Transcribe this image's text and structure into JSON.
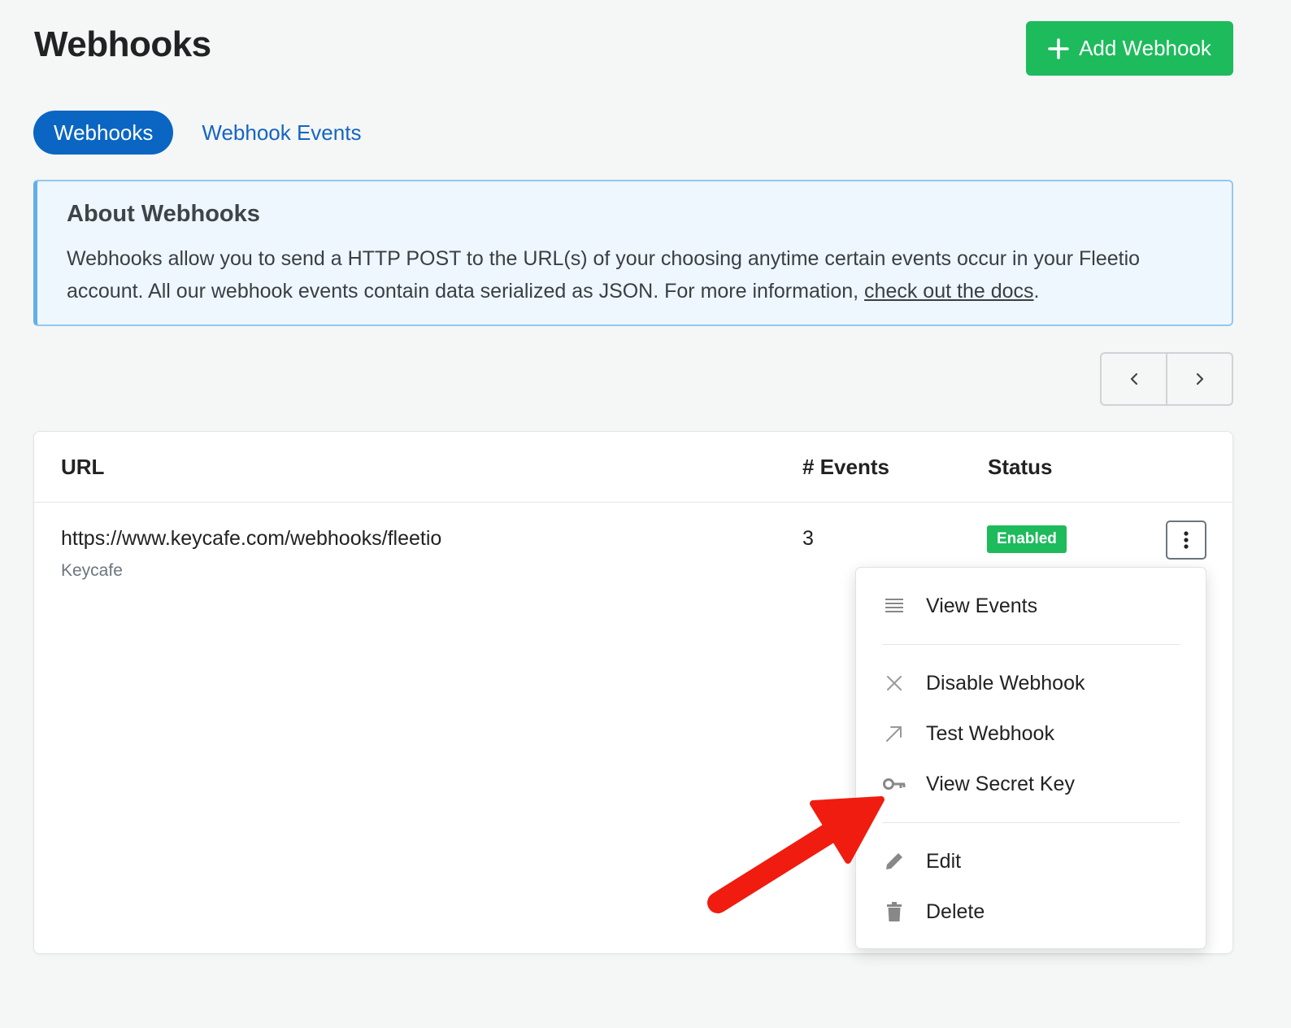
{
  "header": {
    "title": "Webhooks",
    "add_button_label": "Add Webhook"
  },
  "tabs": [
    {
      "label": "Webhooks",
      "active": true
    },
    {
      "label": "Webhook Events",
      "active": false
    }
  ],
  "info": {
    "title": "About Webhooks",
    "body_text": "Webhooks allow you to send a HTTP POST to the URL(s) of your choosing anytime certain events occur in your Fleetio account. All our webhook events contain data serialized as JSON. For more information, ",
    "link_text": "check out the docs",
    "trailing": "."
  },
  "pager": {
    "prev_icon": "chevron-left-icon",
    "next_icon": "chevron-right-icon"
  },
  "table": {
    "columns": [
      "URL",
      "# Events",
      "Status"
    ],
    "rows": [
      {
        "url": "https://www.keycafe.com/webhooks/fleetio",
        "name": "Keycafe",
        "events": "3",
        "status": "Enabled"
      }
    ]
  },
  "actions_menu": {
    "items": [
      {
        "label": "View Events",
        "icon": "list-icon"
      },
      {
        "label": "Disable Webhook",
        "icon": "x-icon"
      },
      {
        "label": "Test Webhook",
        "icon": "arrow-up-right-icon"
      },
      {
        "label": "View Secret Key",
        "icon": "key-icon"
      },
      {
        "label": "Edit",
        "icon": "pencil-icon"
      },
      {
        "label": "Delete",
        "icon": "trash-icon"
      }
    ]
  },
  "colors": {
    "primary_green": "#1dbb5b",
    "primary_blue": "#0a66c2",
    "annotation_red": "#f01c10"
  }
}
